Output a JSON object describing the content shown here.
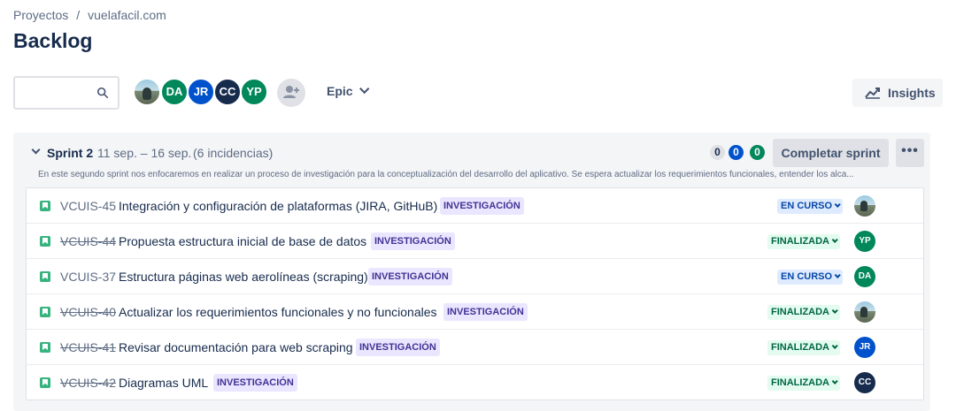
{
  "breadcrumb": {
    "root": "Proyectos",
    "separator": "/",
    "project": "vuelafacil.com"
  },
  "page": {
    "title": "Backlog"
  },
  "search": {
    "placeholder": ""
  },
  "avatars": [
    {
      "initials": "",
      "color": "#8bb7cf",
      "photo": true
    },
    {
      "initials": "DA",
      "color": "#00875a"
    },
    {
      "initials": "JR",
      "color": "#0052cc"
    },
    {
      "initials": "CC",
      "color": "#172b4d"
    },
    {
      "initials": "YP",
      "color": "#00875a"
    }
  ],
  "toolbar": {
    "epic_label": "Epic",
    "insights_label": "Insights"
  },
  "sprint": {
    "name": "Sprint 2",
    "dates": "11 sep. – 16 sep.",
    "count": "(6 incidencias)",
    "counts": {
      "todo": "0",
      "in_progress": "0",
      "done": "0"
    },
    "complete_label": "Completar sprint",
    "more_label": "•••",
    "description": "En este segundo sprint nos enfocaremos en realizar un proceso de investigación para la conceptualización del desarrollo del aplicativo. Se espera actualizar los requerimientos funcionales, entender los alca..."
  },
  "issues": [
    {
      "key": "VCUIS-45",
      "done": false,
      "summary": "Integración y configuración de plataformas (JIRA, GitHuB)",
      "epic": "INVESTIGACIÓN",
      "status": "EN CURSO",
      "assignee": {
        "initials": "",
        "photo": true,
        "color": "#8bb7cf"
      }
    },
    {
      "key": "VCUIS-44",
      "done": true,
      "summary": "Propuesta estructura inicial de base de datos",
      "epic": "INVESTIGACIÓN",
      "status": "FINALIZADA",
      "assignee": {
        "initials": "YP",
        "photo": false,
        "color": "#00875a"
      }
    },
    {
      "key": "VCUIS-37",
      "done": false,
      "summary": "Estructura páginas web aerolíneas (scraping)",
      "epic": "INVESTIGACIÓN",
      "status": "EN CURSO",
      "assignee": {
        "initials": "DA",
        "photo": false,
        "color": "#00875a"
      }
    },
    {
      "key": "VCUIS-40",
      "done": true,
      "summary": "Actualizar los requerimientos funcionales y no funcionales",
      "epic": "INVESTIGACIÓN",
      "status": "FINALIZADA",
      "assignee": {
        "initials": "",
        "photo": true,
        "color": "#8bb7cf"
      }
    },
    {
      "key": "VCUIS-41",
      "done": true,
      "summary": "Revisar documentación para web scraping",
      "epic": "INVESTIGACIÓN",
      "status": "FINALIZADA",
      "assignee": {
        "initials": "JR",
        "photo": false,
        "color": "#0052cc"
      }
    },
    {
      "key": "VCUIS-42",
      "done": true,
      "summary": "Diagramas UML",
      "epic": "INVESTIGACIÓN",
      "status": "FINALIZADA",
      "assignee": {
        "initials": "CC",
        "photo": false,
        "color": "#172b4d"
      }
    }
  ]
}
